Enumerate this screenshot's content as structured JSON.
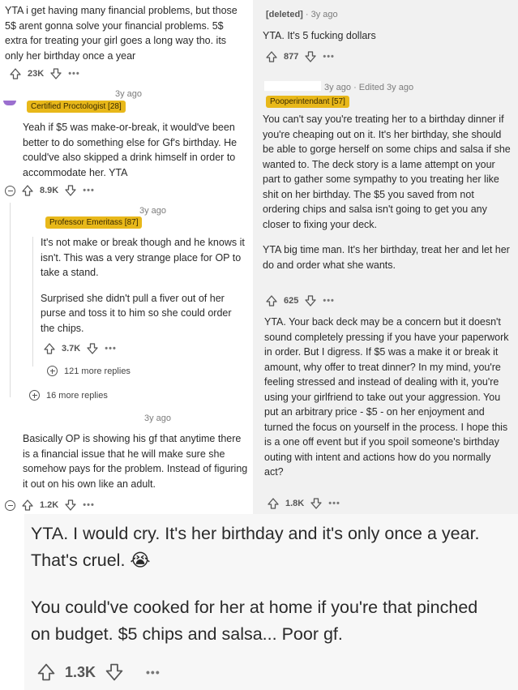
{
  "top_left": {
    "body": "YTA i get having many financial problems, but those 5$ arent gonna solve your financial problems. 5$ extra for treating your girl goes a long way tho. its only her birthday once a year",
    "votes": "23K"
  },
  "proctologist": {
    "age": "3y ago",
    "flair": "Certified Proctologist [28]",
    "body": "Yeah if $5 was make-or-break, it would've been better to do something else for Gf's birthday. He could've also skipped a drink himself in order to accommodate her. YTA",
    "votes": "8.9K"
  },
  "emeritass": {
    "age": "3y ago",
    "flair": "Professor Emeritass [87]",
    "p1": "It's not make or break though and he knows it isn't. This was a very strange place for OP to take a stand.",
    "p2": "Surprised she didn't pull a fiver out of her purse and toss it to him so she could order the chips.",
    "votes": "3.7K",
    "more_replies": "121 more replies"
  },
  "more16": {
    "label": "16 more replies"
  },
  "basically": {
    "age": "3y ago",
    "body": "Basically OP is showing his gf that anytime there is a financial issue that he will make sure she somehow pays for the problem. Instead of figuring it out on his own like an adult.",
    "votes": "1.2K"
  },
  "deleted": {
    "user": "[deleted]",
    "age": "· 3y ago",
    "body": "YTA. It's 5 fucking dollars",
    "votes": "877"
  },
  "pooper": {
    "age": "3y ago · Edited 3y ago",
    "flair": "Pooperintendant [57]",
    "p1": "You can't say you're treating her to a birthday dinner if you're cheaping out on it. It's her birthday, she should be able to gorge herself on some chips and salsa if she wanted to. The deck story is a lame attempt on your part to gather some sympathy to you treating her like shit on her birthday. The $5 you saved from not ordering chips and salsa isn't going to get you any closer to fixing your deck.",
    "p2": "YTA big time man. It's her birthday, treat her and let her do and order what she wants.",
    "votes": "625"
  },
  "backdeck": {
    "body": "YTA. Your back deck may be a concern but it doesn't sound completely pressing if you have your paperwork in order. But I digress. If $5 was a make it or break it amount, why offer to treat dinner? In my mind, you're feeling stressed and instead of dealing with it, you're using your girlfriend to take out your aggression. You put an arbitrary price - $5 - on her enjoyment and turned the focus on yourself in the process. I hope this is a one off event but if you spoil someone's birthday outing with intent and actions how do you normally act?",
    "votes": "1.8K"
  },
  "big": {
    "p1": "YTA. I would cry. It's her birthday and it's only once a year. That's cruel. 😭",
    "p2": "You could've cooked for her at home if you're that pinched on budget. $5 chips and salsa... Poor gf.",
    "votes": "1.3K"
  },
  "colors": {
    "flair": "#e8b81a",
    "big_panel_bg": "#f7f7f7",
    "right_panel_bg": "#f1f1f1"
  }
}
